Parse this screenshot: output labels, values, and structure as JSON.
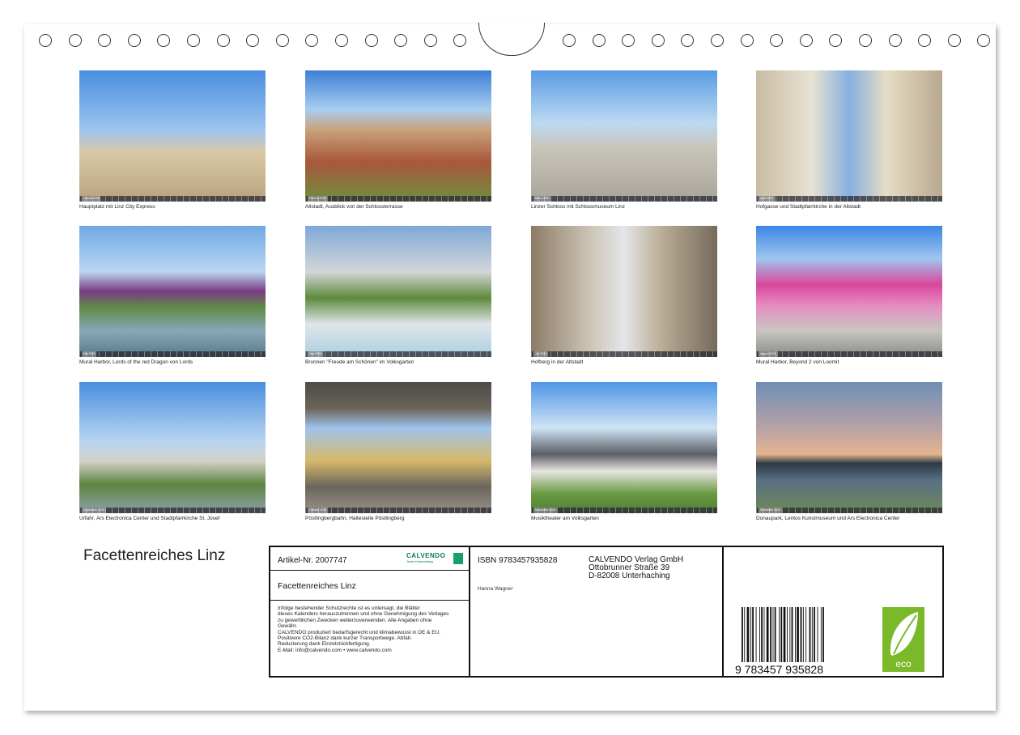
{
  "calendar": {
    "title": "Facettenreiches Linz",
    "photos": [
      {
        "month": "Januar 2026",
        "caption": "Hauptplatz mit Linz City Express"
      },
      {
        "month": "Februar 2026",
        "caption": "Altstadt, Ausblick von der Schlossterrasse"
      },
      {
        "month": "März 2026",
        "caption": "Linzer Schloss mit Schlossmuseum Linz"
      },
      {
        "month": "April 2026",
        "caption": "Hofgasse und Stadtpfarrkirche in der Altstadt"
      },
      {
        "month": "Mai 2026",
        "caption": "Mural Harbor, Lords of the red Dragon von Lords"
      },
      {
        "month": "Juni 2026",
        "caption": "Brunnen \"Freude am Schönen\" im Volksgarten"
      },
      {
        "month": "Juli 2026",
        "caption": "Hofberg in der Altstadt"
      },
      {
        "month": "August 2026",
        "caption": "Mural Harbor, Beyond 2 von Loomit"
      },
      {
        "month": "September 2026",
        "caption": "Urfahr, Ars Electronica Center und Stadtpfarrkirche St. Josef"
      },
      {
        "month": "Oktober 2026",
        "caption": "Pöstlingbergbahn, Haltestelle Pöstlingberg"
      },
      {
        "month": "November 2026",
        "caption": "Musiktheater am Volksgarten"
      },
      {
        "month": "Dezember 2026",
        "caption": "Donaupark, Lentos Kunstmuseum und Ars Electronica Center"
      }
    ]
  },
  "info": {
    "artikel": "Artikel-Nr. 2007747",
    "logo_text": "CALVENDO",
    "logo_sub": "Jeder Kalendertag",
    "subtitle": "Facettenreiches Linz",
    "legal": [
      "Infolge bestehender Schutzrechte ist es untersagt, die Blätter",
      "dieses Kalenders herauszutrennen und ohne Genehmigung des Verlages",
      "zu gewerblichen Zwecken weiterzuverwenden. Alle Angaben ohne",
      "Gewähr.",
      "CALVENDO produziert bedarfsgerecht und klimabewusst in DE & EU.",
      "Positivere CO2-Bilanz dank kurzer Transportwege. Abfall-",
      "Reduzierung dank Einzelstückfertigung.",
      "E-Mail: info@calvendo.com • www.calvendo.com"
    ],
    "isbn": "ISBN 9783457935828",
    "publisher_lines": [
      "CALVENDO Verlag GmbH",
      "Ottobrunner Straße 39",
      "D-82008 Unterhaching"
    ],
    "author": "Hanna Wagner",
    "barcode_digits": "9 783457 935828",
    "eco_label": "eco"
  },
  "colors": {
    "border": "#111111",
    "calvendo_green": "#0a7a55",
    "eco_green": "#7ab929"
  }
}
